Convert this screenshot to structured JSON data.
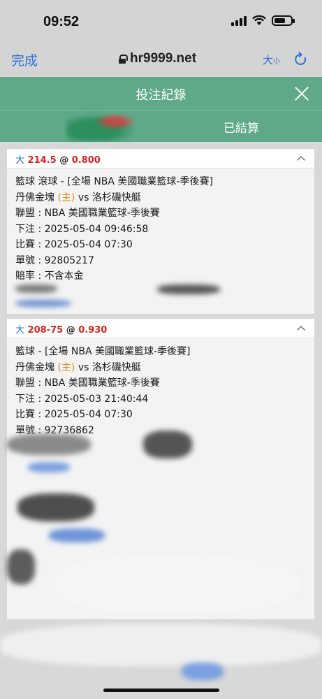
{
  "status": {
    "time": "09:52"
  },
  "browser": {
    "done_label": "完成",
    "url": "hr9999.net",
    "text_size_label_big": "大",
    "text_size_label_small": "小"
  },
  "header": {
    "title": "投注紀錄",
    "tabs": [
      {
        "label": ""
      },
      {
        "label": "已結算"
      }
    ]
  },
  "bets": [
    {
      "ou": "大",
      "line": "214.5",
      "at": "@",
      "odds": "0.800",
      "sport_line": "籃球 滾球 - [全場 NBA 美國職業籃球-季後賽]",
      "team_home": "丹佛金塊",
      "home_tag": "(主)",
      "vs_team": "vs 洛杉磯快艇",
      "league": "聯盟 : NBA 美國職業籃球-季後賽",
      "bet_time": "下注 : 2025-05-04 09:46:58",
      "match_time": "比賽 : 2025-05-04 07:30",
      "ticket": "單號 : 92805217",
      "odds_type": "賠率 : 不含本金"
    },
    {
      "ou": "大",
      "line": "208-75",
      "at": "@",
      "odds": "0.930",
      "sport_line": "籃球 - [全場 NBA 美國職業籃球-季後賽]",
      "team_home": "丹佛金塊",
      "home_tag": "(主)",
      "vs_team": "vs 洛杉磯快艇",
      "league": "聯盟 : NBA 美國職業籃球-季後賽",
      "bet_time": "下注 : 2025-05-03 21:40:44",
      "match_time": "比賽 : 2025-05-04 07:30",
      "ticket": "單號 : 92736862"
    }
  ],
  "colors": {
    "accent_green": "#5fa989",
    "link_blue": "#2b6fd6",
    "odds_red": "#d8241e",
    "home_orange": "#e38b1f"
  }
}
